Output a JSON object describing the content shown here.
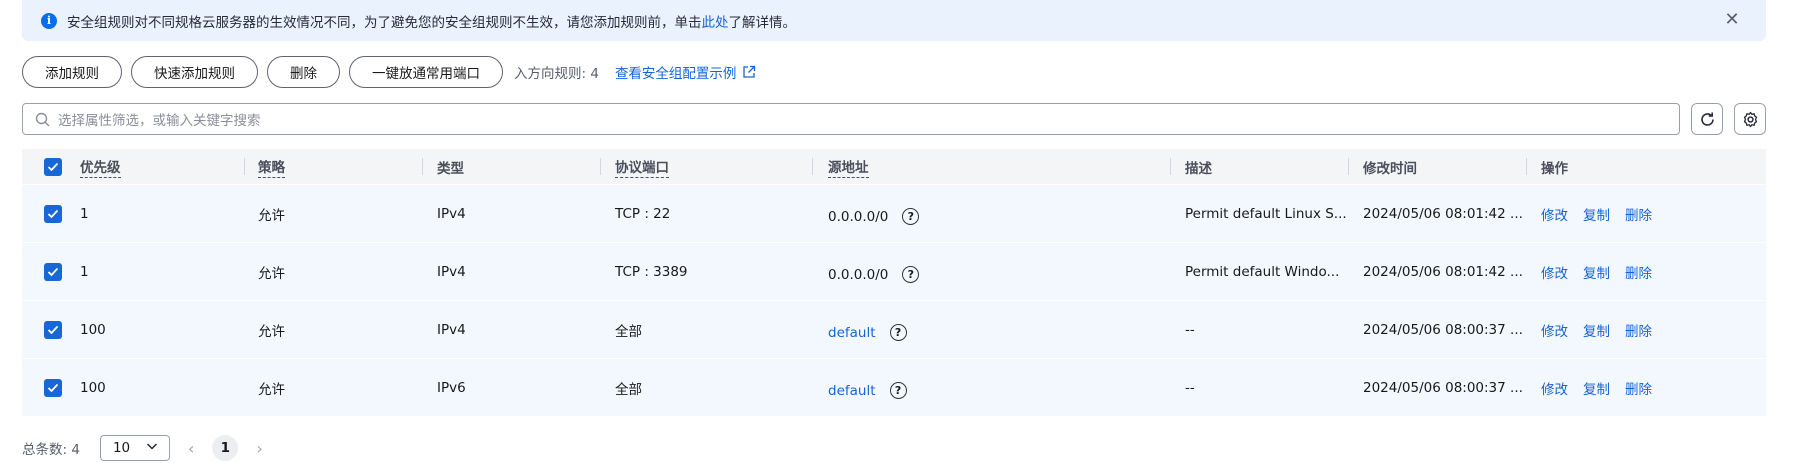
{
  "notice": {
    "text_before": "安全组规则对不同规格云服务器的生效情况不同，为了避免您的安全组规则不生效，请您添加规则前，单击",
    "link": "此处",
    "text_after": "了解详情。"
  },
  "toolbar": {
    "add_rule": "添加规则",
    "quick_add": "快速添加规则",
    "delete": "删除",
    "open_common_ports": "一键放通常用端口",
    "inbound_count": "入方向规则: 4",
    "example_link": "查看安全组配置示例"
  },
  "search": {
    "placeholder": "选择属性筛选，或输入关键字搜索"
  },
  "table": {
    "columns": {
      "priority": "优先级",
      "policy": "策略",
      "type": "类型",
      "protocol_port": "协议端口",
      "source": "源地址",
      "description": "描述",
      "modified": "修改时间",
      "actions": "操作"
    },
    "rows": [
      {
        "priority": "1",
        "policy": "允许",
        "type": "IPv4",
        "protocol_port": "TCP : 22",
        "source": "0.0.0.0/0",
        "description": "Permit default Linux S...",
        "modified": "2024/05/06 08:01:42 ..."
      },
      {
        "priority": "1",
        "policy": "允许",
        "type": "IPv4",
        "protocol_port": "TCP : 3389",
        "source": "0.0.0.0/0",
        "description": "Permit default Windo...",
        "modified": "2024/05/06 08:01:42 ..."
      },
      {
        "priority": "100",
        "policy": "允许",
        "type": "IPv4",
        "protocol_port": "全部",
        "source": "default",
        "description": "--",
        "modified": "2024/05/06 08:00:37 ..."
      },
      {
        "priority": "100",
        "policy": "允许",
        "type": "IPv6",
        "protocol_port": "全部",
        "source": "default",
        "description": "--",
        "modified": "2024/05/06 08:00:37 ..."
      }
    ],
    "actions": {
      "edit": "修改",
      "copy": "复制",
      "delete": "删除"
    },
    "help_glyph": "?"
  },
  "footer": {
    "total": "总条数: 4",
    "page_size": "10",
    "current_page": "1"
  },
  "colors": {
    "accent": "#1464d8",
    "notice_bg": "#eaf2fe",
    "row_selected": "#f3f8ff"
  }
}
